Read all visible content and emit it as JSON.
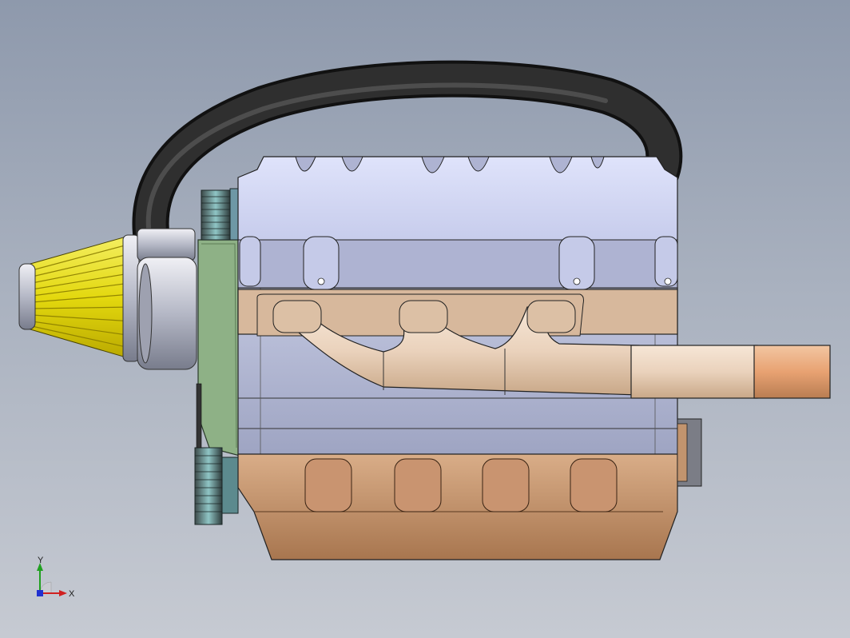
{
  "viewport": {
    "background_top": "#8e99ac",
    "background_bottom": "#c6cad2"
  },
  "model": {
    "subject": "engine-assembly",
    "colors": {
      "valve_cover": "#c9cff0",
      "block": "#aeb4d0",
      "oil_pan": "#c69672",
      "exhaust_header": "#e9cfb4",
      "exhaust_pipe_tip": "#e0a070",
      "intake_hose": "#2a2a2a",
      "air_filter": "#e8e020",
      "timing_cover": "#8fb085"
    }
  },
  "triad": {
    "x_label": "X",
    "y_label": "Y",
    "x_color": "#d02020",
    "y_color": "#20a020",
    "z_color": "#2030d0"
  }
}
